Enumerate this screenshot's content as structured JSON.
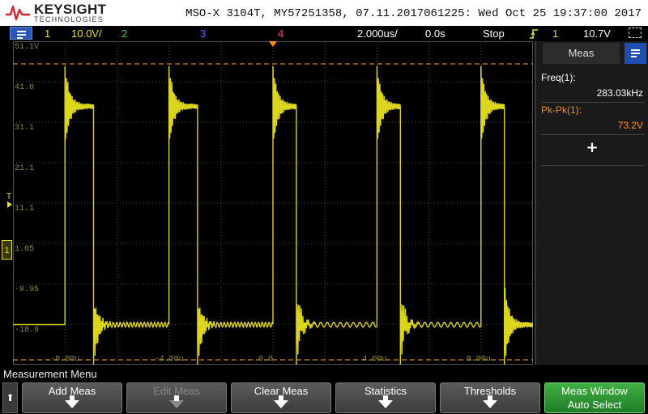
{
  "header": {
    "brand": "KEYSIGHT",
    "brand_sub": "TECHNOLOGIES",
    "instrument_info": "MSO-X 3104T, MY57251358, 07.11.2017061225: Wed Oct 25 19:37:00 2017"
  },
  "status_bar": {
    "ch1": "1",
    "ch1_scale": "10.0V/",
    "ch2": "2",
    "ch3": "3",
    "ch4": "4",
    "timebase": "2.000us/",
    "delay": "0.0s",
    "run_state": "Stop",
    "trigger_icon": "trigger-rising-edge-icon",
    "trigger_channel": "1",
    "trigger_level": "10.7V"
  },
  "graticule": {
    "y_labels": [
      "51.1V",
      "41.0",
      "31.1",
      "21.1",
      "11.1",
      "1.05",
      "-8.95",
      "-18.9"
    ],
    "x_labels": [
      "-8.00u",
      "-4.00u",
      "0.0",
      "4.00u",
      "8.00u"
    ],
    "trigger_marker": "T",
    "ground_marker": "1"
  },
  "chart_data": {
    "type": "line",
    "xlabel": "",
    "ylabel": "",
    "x_unit": "us",
    "y_unit": "V",
    "xlim": [
      -10,
      10
    ],
    "ylim": [
      -28.9,
      51.1
    ],
    "grid": true,
    "series": [
      {
        "color": "#e8e020",
        "period_us": 3.533,
        "high_level_v": 35,
        "low_level_v": -19,
        "rising_edges_us": [
          -8.0,
          -4.0,
          0.0,
          4.0,
          8.0
        ],
        "falling_edges_us": [
          -6.9,
          -2.9,
          0.9,
          4.9,
          8.9
        ]
      }
    ]
  },
  "measurements": {
    "tab_label": "Meas",
    "items": [
      {
        "label": "Freq(1):",
        "value": "283.03kHz"
      },
      {
        "label": "Pk-Pk(1):",
        "value": "73.2V"
      }
    ],
    "add_symbol": "+"
  },
  "softkeys": {
    "menu_title": "Measurement Menu",
    "up_symbol": "⬆",
    "buttons": [
      {
        "label": "Add Meas"
      },
      {
        "label": "Edit Meas"
      },
      {
        "label": "Clear Meas"
      },
      {
        "label": "Statistics"
      },
      {
        "label": "Thresholds"
      },
      {
        "label": "Meas Window",
        "label2": "Auto Select"
      }
    ]
  },
  "colors": {
    "ch1": "#e8e020",
    "ch2": "#3fd04a",
    "ch3": "#4f6bff",
    "ch4": "#ff3aa0",
    "meas_label": "#ff8c1a",
    "accent_blue": "#2a56b8",
    "green_key": "#2e9a35"
  }
}
